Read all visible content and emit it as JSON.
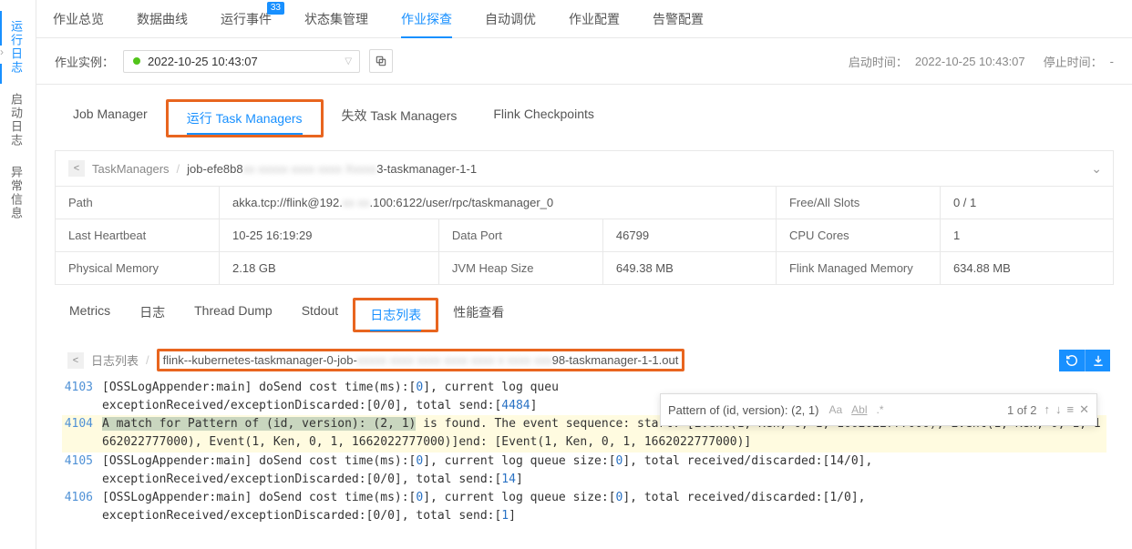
{
  "sidebar": {
    "items": [
      {
        "label": "运行日志"
      },
      {
        "label": "启动日志"
      },
      {
        "label": "异常信息"
      }
    ]
  },
  "topTabs": {
    "items": [
      {
        "label": "作业总览"
      },
      {
        "label": "数据曲线"
      },
      {
        "label": "运行事件",
        "badge": "33"
      },
      {
        "label": "状态集管理"
      },
      {
        "label": "作业探查"
      },
      {
        "label": "自动调优"
      },
      {
        "label": "作业配置"
      },
      {
        "label": "告警配置"
      }
    ]
  },
  "instance": {
    "label": "作业实例：",
    "selected": "2022-10-25 10:43:07",
    "startLabel": "启动时间：",
    "startValue": "2022-10-25 10:43:07",
    "stopLabel": "停止时间：",
    "stopValue": "-"
  },
  "subTabs": {
    "items": [
      {
        "label": "Job Manager"
      },
      {
        "label": "运行 Task Managers"
      },
      {
        "label": "失效 Task Managers"
      },
      {
        "label": "Flink Checkpoints"
      }
    ]
  },
  "breadcrumb": {
    "back": "TaskManagers",
    "currentPre": "job-efe8b8",
    "currentBlur": "xx  xxxxx xxxx  xxxx  Xxxxx",
    "currentPost": "3-taskmanager-1-1"
  },
  "info": {
    "pathLabel": "Path",
    "pathPre": "akka.tcp://flink@192.",
    "pathBlur": "xx xx",
    "pathPost": ".100:6122/user/rpc/taskmanager_0",
    "slotsLabel": "Free/All Slots",
    "slotsValue": "0 / 1",
    "heartbeatLabel": "Last Heartbeat",
    "heartbeatValue": "10-25 16:19:29",
    "dataPortLabel": "Data Port",
    "dataPortValue": "46799",
    "cpuLabel": "CPU Cores",
    "cpuValue": "1",
    "physMemLabel": "Physical Memory",
    "physMemValue": "2.18 GB",
    "heapLabel": "JVM Heap Size",
    "heapValue": "649.38 MB",
    "managedLabel": "Flink Managed Memory",
    "managedValue": "634.88 MB"
  },
  "subSubTabs": {
    "items": [
      {
        "label": "Metrics"
      },
      {
        "label": "日志"
      },
      {
        "label": "Thread Dump"
      },
      {
        "label": "Stdout"
      },
      {
        "label": "日志列表"
      },
      {
        "label": "性能查看"
      }
    ]
  },
  "logBreadcrumb": {
    "back": "日志列表",
    "currentPre": "flink--kubernetes-taskmanager-0-job-",
    "currentBlur": "xxxxx  xxxx xxxx xxxx xxxx x xxxx xxx",
    "currentPost": "98-taskmanager-1-1.out"
  },
  "log": {
    "l4103": {
      "num": "4103",
      "p1": "[OSSLogAppender:main] doSend cost time(ms):[",
      "n1": "0",
      "p2": "], current log queu",
      "p3": "exceptionReceived/exceptionDiscarded:[0/0], total send:[",
      "n2": "4484",
      "p4": "]"
    },
    "l4104": {
      "num": "4104",
      "match": "A match for Pattern of (id, version): (2, 1)",
      "rest": " is found. The event sequence: start: [Event(1, Ken, 0, 1, 1662022777000), Event(1, Ken, 0, 1, 1662022777000), Event(1, Ken, 0, 1, 1662022777000)]end: [Event(1, Ken, 0, 1, 1662022777000)]"
    },
    "l4105": {
      "num": "4105",
      "p1": "[OSSLogAppender:main] doSend cost time(ms):[",
      "n1": "0",
      "p2": "], current log queue size:[",
      "n2": "0",
      "p3": "], total received/discarded:[14/0], ",
      "p4": "exceptionReceived/exceptionDiscarded:[0/0], total send:[",
      "n3": "14",
      "p5": "]"
    },
    "l4106": {
      "num": "4106",
      "p1": "[OSSLogAppender:main] doSend cost time(ms):[",
      "n1": "0",
      "p2": "], current log queue size:[",
      "n2": "0",
      "p3": "], total received/discarded:[1/0], ",
      "p4": "exceptionReceived/exceptionDiscarded:[0/0], total send:[",
      "n3": "1",
      "p5": "]"
    }
  },
  "search": {
    "text": "Pattern of (id, version): (2, 1)",
    "opts": {
      "case": "Aa",
      "word": "Abl",
      "regex": ".*"
    },
    "count": "1 of 2"
  }
}
